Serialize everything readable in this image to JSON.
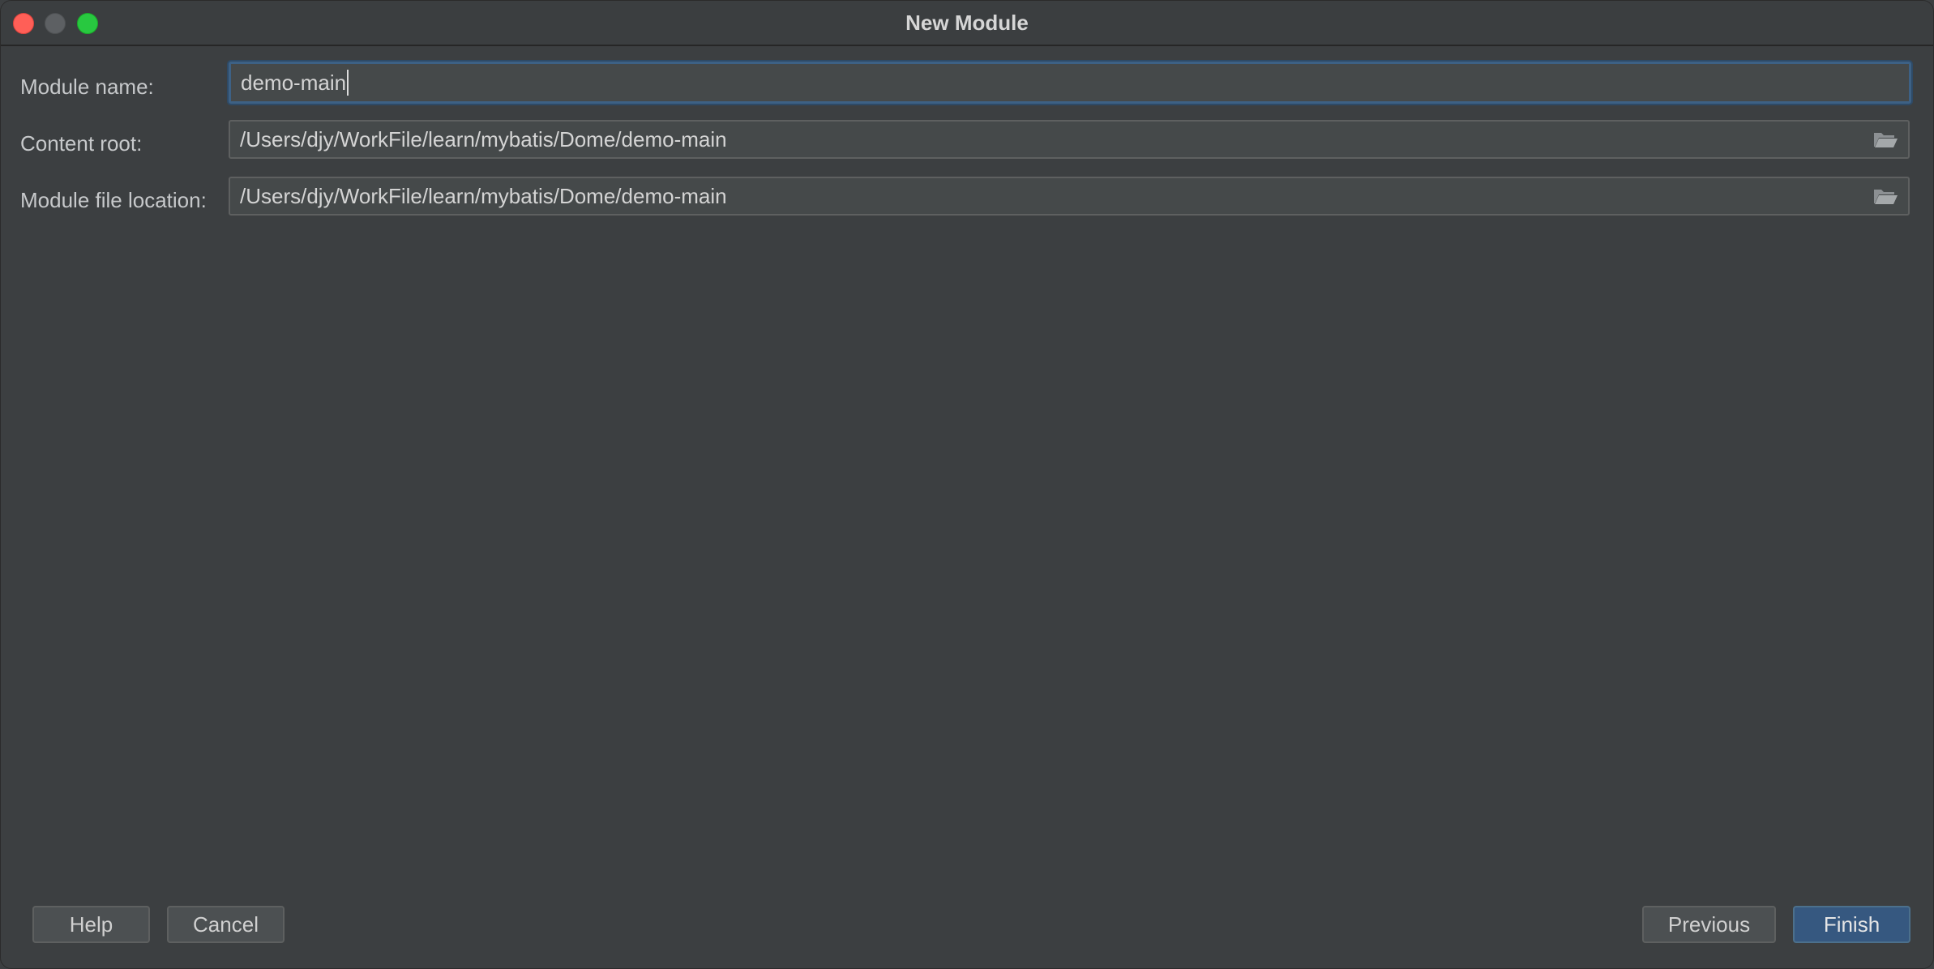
{
  "window": {
    "title": "New Module"
  },
  "form": {
    "module_name": {
      "label": "Module name:",
      "value": "demo-main"
    },
    "content_root": {
      "label": "Content root:",
      "value": "/Users/djy/WorkFile/learn/mybatis/Dome/demo-main",
      "icon": "folder-open-icon"
    },
    "module_file_location": {
      "label": "Module file location:",
      "value": "/Users/djy/WorkFile/learn/mybatis/Dome/demo-main",
      "icon": "folder-open-icon"
    }
  },
  "buttons": {
    "help": "Help",
    "cancel": "Cancel",
    "previous": "Previous",
    "finish": "Finish"
  },
  "colors": {
    "background": "#3c3f41",
    "field_background": "#45494a",
    "focus_border": "#3d6185",
    "primary_button": "#365880",
    "close": "#ff5f57",
    "maximize": "#28c840"
  }
}
